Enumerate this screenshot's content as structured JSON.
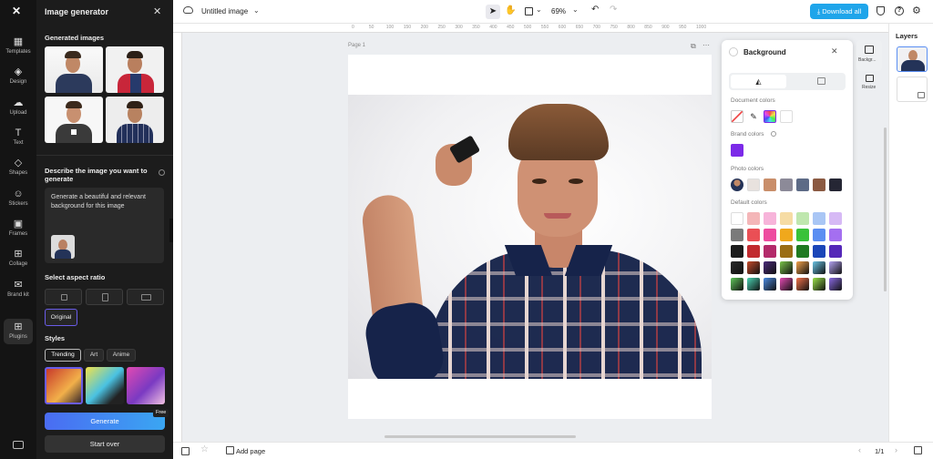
{
  "rail": {
    "items": [
      {
        "label": "Templates",
        "icon": "templates-icon",
        "glyph": "▦"
      },
      {
        "label": "Design",
        "icon": "design-icon",
        "glyph": "◈"
      },
      {
        "label": "Upload",
        "icon": "upload-icon",
        "glyph": "☁"
      },
      {
        "label": "Text",
        "icon": "text-icon",
        "glyph": "T"
      },
      {
        "label": "Shapes",
        "icon": "shapes-icon",
        "glyph": "◇"
      },
      {
        "label": "Stickers",
        "icon": "stickers-icon",
        "glyph": "☺"
      },
      {
        "label": "Frames",
        "icon": "frames-icon",
        "glyph": "▣"
      },
      {
        "label": "Collage",
        "icon": "collage-icon",
        "glyph": "⊞"
      },
      {
        "label": "Brand kit",
        "icon": "brand-kit-icon",
        "glyph": "✉"
      },
      {
        "label": "Plugins",
        "icon": "plugins-icon",
        "glyph": "⊞"
      }
    ]
  },
  "panel": {
    "title": "Image generator",
    "generated_label": "Generated images",
    "describe_label": "Describe the image you want to generate",
    "prompt_text": "Generate a beautiful and relevant background for this image",
    "aspect_label": "Select aspect ratio",
    "original_label": "Original",
    "styles_label": "Styles",
    "style_tabs": [
      "Trending",
      "Art",
      "Anime"
    ],
    "free_badge": "Free",
    "generate_label": "Generate",
    "start_over_label": "Start over"
  },
  "topbar": {
    "doc_title": "Untitled image",
    "zoom": "69%",
    "download_label": "Download all"
  },
  "canvas": {
    "page_label": "Page 1",
    "ruler_marks": [
      "0",
      "50",
      "100",
      "150",
      "200",
      "250",
      "300",
      "350",
      "400",
      "450",
      "500",
      "550",
      "600",
      "650",
      "700",
      "750",
      "800",
      "850",
      "900",
      "950",
      "1000"
    ]
  },
  "background_panel": {
    "title": "Background",
    "document_colors_label": "Document colors",
    "brand_colors_label": "Brand colors",
    "photo_colors_label": "Photo colors",
    "default_colors_label": "Default colors",
    "brand_color": "#7c2ae8",
    "photo_colors": [
      "#e8e2de",
      "#c98e6a",
      "#8c8a98",
      "#5d6b86",
      "#8b5a42",
      "#252634"
    ],
    "default_rows": [
      [
        "#ffffff",
        "#f4b6b8",
        "#f7b4da",
        "#f6dca4",
        "#bfe7ae",
        "#a9c6f5",
        "#d6b9f5"
      ],
      [
        "#7a7a7a",
        "#ea4f55",
        "#ee4c9f",
        "#f0a81c",
        "#39c23a",
        "#5b8ef2",
        "#a46ff0"
      ],
      [
        "#1c1c1c",
        "#c12a2e",
        "#b32a6a",
        "#9a6d14",
        "#1f7a21",
        "#1b46b8",
        "#5427b8"
      ],
      [
        "#2a2a2a",
        "#c54a2a",
        "#4a2a7a",
        "#7ac44a",
        "#f2a24a",
        "#6ac2e2",
        "#b4a2f2"
      ],
      [
        "#5ec45a",
        "#4ad2b2",
        "#4a8ae2",
        "#e24ab2",
        "#f2724a",
        "#9ae24a",
        "#8a6ae2"
      ]
    ]
  },
  "side": {
    "background_tab": "Backgr...",
    "resize_tab": "Resize",
    "layers_label": "Layers"
  },
  "bottombar": {
    "add_page_label": "Add page",
    "page_count": "1/1"
  }
}
